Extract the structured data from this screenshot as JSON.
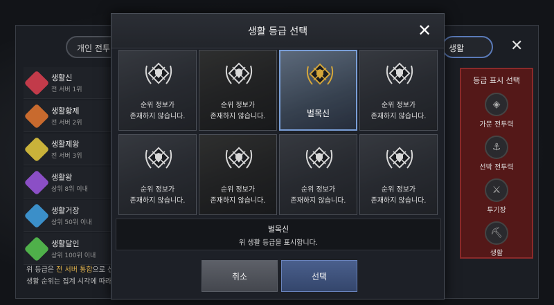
{
  "background": {
    "tab_left": "개인 전투",
    "tab_right": "생활",
    "close_glyph": "✕",
    "ranks": [
      {
        "name": "생활신",
        "sub": "전 서버 1위",
        "color": "#c23b4a"
      },
      {
        "name": "생활황제",
        "sub": "전 서버 2위",
        "color": "#c86a2e"
      },
      {
        "name": "생활제왕",
        "sub": "전 서버 3위",
        "color": "#c9b23a"
      },
      {
        "name": "생활왕",
        "sub": "상위 8위 이내",
        "color": "#8b4fc6"
      },
      {
        "name": "생활거장",
        "sub": "상위 50위 이내",
        "color": "#3b8fc9"
      },
      {
        "name": "생활달인",
        "sub": "상위 100위 이내",
        "color": "#4fb04a"
      }
    ],
    "note_line1_pre": "위 등급은 ",
    "note_line1_hl": "전 서버 통합",
    "note_line1_post": "으로 산출되고, 랭킹 산출 ...",
    "note_line2": "생활 순위는 집계 시각에 따라 오차가 있을 수 있습...",
    "right_panel": {
      "title": "등급 표시 선택",
      "items": [
        {
          "label": "가문 전투력",
          "icon": "shield-icon"
        },
        {
          "label": "선박 전투력",
          "icon": "ship-icon"
        },
        {
          "label": "투기장",
          "icon": "swords-icon"
        },
        {
          "label": "생활",
          "icon": "pickaxe-icon"
        }
      ]
    }
  },
  "modal": {
    "title": "생활 등급 선택",
    "close_glyph": "✕",
    "cards": [
      {
        "text1": "순위 정보가",
        "text2": "존재하지 않습니다.",
        "selected": false
      },
      {
        "text1": "순위 정보가",
        "text2": "존재하지 않습니다.",
        "selected": false
      },
      {
        "text1": "벌목신",
        "text2": "",
        "selected": true
      },
      {
        "text1": "순위 정보가",
        "text2": "존재하지 않습니다.",
        "selected": false
      },
      {
        "text1": "순위 정보가",
        "text2": "존재하지 않습니다.",
        "selected": false
      },
      {
        "text1": "순위 정보가",
        "text2": "존재하지 않습니다.",
        "selected": false
      },
      {
        "text1": "순위 정보가",
        "text2": "존재하지 않습니다.",
        "selected": false
      },
      {
        "text1": "순위 정보가",
        "text2": "존재하지 않습니다.",
        "selected": false
      }
    ],
    "description": {
      "name": "벌목신",
      "text": "위 생활 등급을 표시합니다."
    },
    "cancel_label": "취소",
    "select_label": "선택",
    "accent_color": "#7a9fd8",
    "gold_color": "#d4a63a"
  }
}
